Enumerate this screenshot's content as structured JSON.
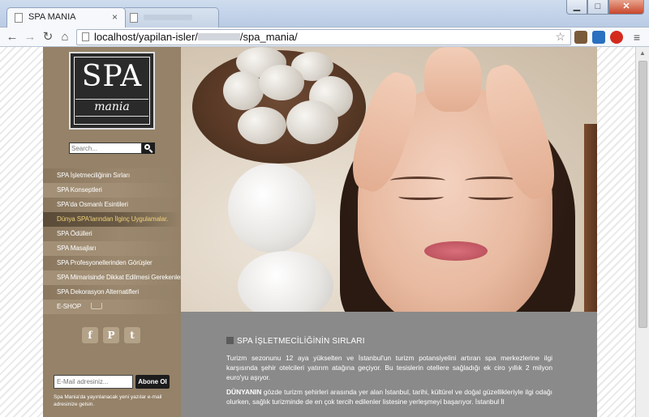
{
  "browser": {
    "active_tab_title": "SPA MANIA",
    "tab_close": "×",
    "url_prefix": "localhost/yapilan-isler/",
    "url_suffix": "/spa_mania/",
    "window_buttons": {
      "minimize": "▁",
      "maximize": "□",
      "close": "✕"
    },
    "nav_icons": {
      "back": "←",
      "forward": "→",
      "reload": "↻",
      "home": "⌂",
      "star": "☆",
      "menu": "≡"
    }
  },
  "logo": {
    "main": "SPA",
    "sub": "mania"
  },
  "search": {
    "placeholder": "Search..."
  },
  "menu": {
    "items": [
      "SPA İşletmeciliğinin Sırları",
      "SPA Konseptleri",
      "SPA'da Osmanlı Esintileri",
      "Dünya SPA'larından İlginç Uygulamalar.",
      "SPA Ödülleri",
      "SPA Masajları",
      "SPA Profesyonellerinden Görüşler",
      "SPA Mimarisinde Dikkat Edilmesi Gerekenler",
      "SPA Dekorasyon Alternatifleri",
      "E-SHOP"
    ],
    "active_index": 3
  },
  "social": {
    "facebook": "f",
    "pinterest": "P",
    "twitter": "t"
  },
  "newsletter": {
    "placeholder": "E-Mail adresiniz...",
    "button": "Abone Ol",
    "note": "Spa Mania'da yayınlanacak yeni yazılar e-mail adresinize gelsin."
  },
  "article": {
    "title": "SPA İŞLETMECİLİĞİNİN SIRLARI",
    "p1": "Turizm sezonunu 12 aya yükselten ve İstanbul'un turizm potansiyelini artıran spa merkezlerine ilgi karşısında şehir otelcileri yatırım atağına geçiyor. Bu tesislerin otellere sağladığı ek ciro yıllık 2 milyon euro'yu aşıyor.",
    "p2_lead": "DÜNYANIN",
    "p2": " gözde turizm şehirleri arasında yer alan İstanbul, tarihi, kültürel ve doğal güzellikleriyle ilgi odağı olurken, sağlık turizminde de en çok tercih edilenler listesine yerleşmeyi başarıyor. İstanbul İl"
  },
  "colors": {
    "sidebar": "#958268",
    "content": "#8a8a8a",
    "active_menu_text": "#f0d27a"
  }
}
